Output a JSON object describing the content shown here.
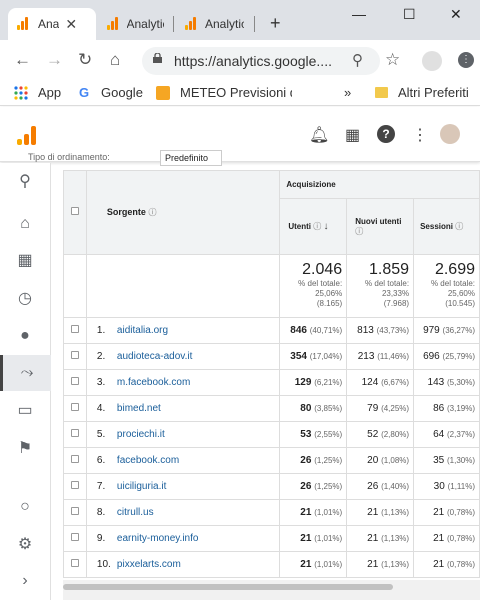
{
  "browser": {
    "tabs": [
      {
        "label": "Ana",
        "active": true
      },
      {
        "label": "Analytic",
        "active": false
      },
      {
        "label": "Analytic",
        "active": false
      }
    ],
    "url": "https://analytics.google....",
    "bookmarks": {
      "apps": "App",
      "google": "Google",
      "meteo": "METEO Previsioni del",
      "more": "»",
      "other": "Altri Preferiti"
    }
  },
  "report": {
    "filter_label": "Tipo di ordinamento:",
    "filter_value": "Predefinito",
    "group_header": "Acquisizione",
    "col_source": "Sorgente",
    "col_users": "Utenti",
    "col_new_users": "Nuovi utenti",
    "col_sessions": "Sessioni",
    "totals": {
      "users": "2.046",
      "users_pct": "% del totale:",
      "users_share": "25,06%",
      "users_total": "(8.165)",
      "new_users": "1.859",
      "new_users_pct": "% del totale:",
      "new_users_share": "23,33%",
      "new_users_total": "(7.968)",
      "sessions": "2.699",
      "sessions_pct": "% del totale:",
      "sessions_share": "25,60%",
      "sessions_total": "(10.545)"
    },
    "rows": [
      {
        "idx": "1.",
        "source": "aiditalia.org",
        "users": "846",
        "users_pct": "(40,71%)",
        "new": "813",
        "new_pct": "(43,73%)",
        "sess": "979",
        "sess_pct": "(36,27%)"
      },
      {
        "idx": "2.",
        "source": "audioteca-adov.it",
        "users": "354",
        "users_pct": "(17,04%)",
        "new": "213",
        "new_pct": "(11,46%)",
        "sess": "696",
        "sess_pct": "(25,79%)"
      },
      {
        "idx": "3.",
        "source": "m.facebook.com",
        "users": "129",
        "users_pct": "(6,21%)",
        "new": "124",
        "new_pct": "(6,67%)",
        "sess": "143",
        "sess_pct": "(5,30%)"
      },
      {
        "idx": "4.",
        "source": "bimed.net",
        "users": "80",
        "users_pct": "(3,85%)",
        "new": "79",
        "new_pct": "(4,25%)",
        "sess": "86",
        "sess_pct": "(3,19%)"
      },
      {
        "idx": "5.",
        "source": "prociechi.it",
        "users": "53",
        "users_pct": "(2,55%)",
        "new": "52",
        "new_pct": "(2,80%)",
        "sess": "64",
        "sess_pct": "(2,37%)"
      },
      {
        "idx": "6.",
        "source": "facebook.com",
        "users": "26",
        "users_pct": "(1,25%)",
        "new": "20",
        "new_pct": "(1,08%)",
        "sess": "35",
        "sess_pct": "(1,30%)"
      },
      {
        "idx": "7.",
        "source": "uiciliguria.it",
        "users": "26",
        "users_pct": "(1,25%)",
        "new": "26",
        "new_pct": "(1,40%)",
        "sess": "30",
        "sess_pct": "(1,11%)"
      },
      {
        "idx": "8.",
        "source": "citrull.us",
        "users": "21",
        "users_pct": "(1,01%)",
        "new": "21",
        "new_pct": "(1,13%)",
        "sess": "21",
        "sess_pct": "(0,78%)"
      },
      {
        "idx": "9.",
        "source": "earnity-money.info",
        "users": "21",
        "users_pct": "(1,01%)",
        "new": "21",
        "new_pct": "(1,13%)",
        "sess": "21",
        "sess_pct": "(0,78%)"
      },
      {
        "idx": "10.",
        "source": "pixxelarts.com",
        "users": "21",
        "users_pct": "(1,01%)",
        "new": "21",
        "new_pct": "(1,13%)",
        "sess": "21",
        "sess_pct": "(0,78%)"
      }
    ]
  },
  "colors": {
    "ga_orange": "#f57c00",
    "ga_yellow": "#f9ab00",
    "link": "#1a5e9a"
  }
}
